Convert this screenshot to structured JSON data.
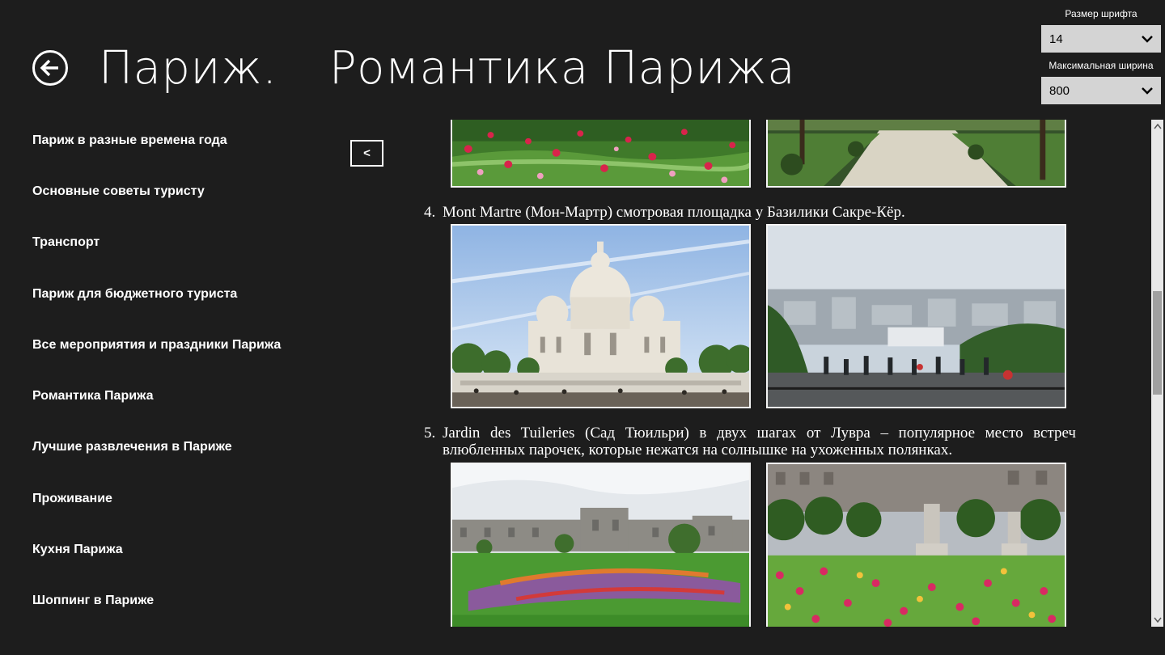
{
  "header": {
    "app_title": "Париж.",
    "page_title": "Романтика Парижа"
  },
  "controls": {
    "font_size_label": "Размер шрифта",
    "font_size_value": "14",
    "max_width_label": "Максимальная ширина",
    "max_width_value": "800"
  },
  "nav": {
    "collapse_label": "<",
    "items": [
      {
        "label": "Париж в разные времена года"
      },
      {
        "label": "Основные советы туристу"
      },
      {
        "label": "Транспорт"
      },
      {
        "label": "Париж для бюджетного туриста"
      },
      {
        "label": "Все мероприятия и праздники Парижа"
      },
      {
        "label": "Романтика Парижа"
      },
      {
        "label": "Лучшие развлечения в Париже"
      },
      {
        "label": "Проживание"
      },
      {
        "label": "Кухня Парижа"
      },
      {
        "label": "Шоппинг в Париже"
      }
    ]
  },
  "content": {
    "items": [
      {
        "number": "4.",
        "text": "Mont Martre (Мон-Мартр) смотровая площадка у Базилики Сакре-Кёр."
      },
      {
        "number": "5.",
        "text": "Jardin des Tuileries (Сад Тюильри) в двух шагах от Лувра – популярное место встреч влюбленных парочек, которые нежатся на солнышке на ухоженных полянках."
      }
    ]
  },
  "scrollbar": {
    "position": 0.42
  }
}
